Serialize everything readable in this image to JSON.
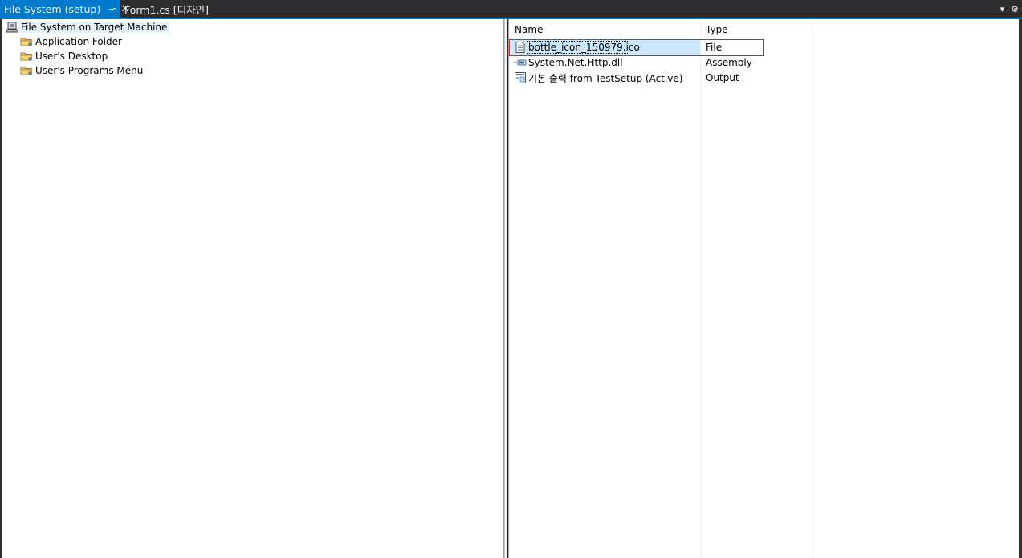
{
  "tabs": [
    {
      "label": "File System (setup)",
      "pin_glyph": "⊸",
      "close_glyph": "✕"
    },
    {
      "label": "Form1.cs [디자인]"
    }
  ],
  "tabbar_controls": {
    "dropdown_glyph": "▾",
    "settings_glyph": "⚙"
  },
  "tree": {
    "root": "File System on Target Machine",
    "children": [
      "Application Folder",
      "User's Desktop",
      "User's Programs Menu"
    ]
  },
  "list": {
    "columns": [
      "Name",
      "Type"
    ],
    "rows": [
      {
        "name": "bottle_icon_150979.ico",
        "type": "File",
        "icon": "file-icon"
      },
      {
        "name": "System.Net.Http.dll",
        "type": "Assembly",
        "icon": "assembly-icon"
      },
      {
        "name": "기본 출력 from TestSetup (Active)",
        "type": "Output",
        "icon": "output-icon"
      }
    ]
  },
  "colors": {
    "accent": "#007acc",
    "selection": "#cce8ff",
    "highlight_border": "#d9232e"
  }
}
